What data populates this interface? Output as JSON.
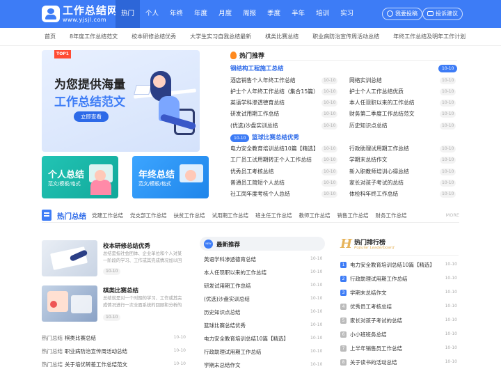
{
  "header": {
    "logo_title": "工作总结网",
    "logo_url": "www.yjsjl.com",
    "nav": [
      "热门",
      "个人",
      "年终",
      "年度",
      "月度",
      "周报",
      "季度",
      "半年",
      "培训",
      "实习"
    ],
    "pill_submit": "我要投稿",
    "pill_feedback": "投诉建议",
    "brand_color": "#3d7cf6"
  },
  "subnav": [
    "首页",
    "8年度工作总结范文",
    "校本研修总结优秀",
    "大学生实习自我总结最新",
    "棋类比赛总结",
    "职业病防治宣传周活动总结",
    "年终工作总结及明年工作计划"
  ],
  "banner": {
    "tag": "TOP1",
    "line1": "为您提供海量",
    "line2": "工作总结范文",
    "button": "立即查看"
  },
  "cards": [
    {
      "title": "个人总结",
      "sub": "范文/模板/格式"
    },
    {
      "title": "年终总结",
      "sub": "范文/模板/格式"
    }
  ],
  "hot": {
    "label": "热门推荐",
    "feature1": {
      "title": "钢结构工程施工总结",
      "date": "10-10"
    },
    "feature2": {
      "title": "篮球比赛总结优秀",
      "date": "10-10"
    },
    "left1": [
      {
        "t": "酒店销售个人年终工作总结",
        "d": "10-10"
      },
      {
        "t": "护士个人年终工作总结（集合15篇）",
        "d": "10-10"
      },
      {
        "t": "英语学科渗透德育总结",
        "d": "10-10"
      },
      {
        "t": "研发试用期工作总结",
        "d": "10-10"
      },
      {
        "t": "(优选)沙盘实训总结",
        "d": "10-10"
      }
    ],
    "right1": [
      {
        "t": "网络实训总结",
        "d": "10-10"
      },
      {
        "t": "护士个人工作总结优质",
        "d": "10-10"
      },
      {
        "t": "本人任现职以来的工作总结",
        "d": "10-10"
      },
      {
        "t": "财务第二季度工作总结范文",
        "d": "10-10"
      },
      {
        "t": "历史知识点总结",
        "d": "10-10"
      }
    ],
    "left2": [
      {
        "t": "电力安全教育培训总结10篇【精选】",
        "d": "10-10"
      },
      {
        "t": "工厂员工试用期转正个人工作总结",
        "d": "10-10"
      },
      {
        "t": "优秀员工考核总结",
        "d": "10-10"
      },
      {
        "t": "普通员工简短个人总结",
        "d": "10-10"
      },
      {
        "t": "社工岗年度考核个人总结",
        "d": "10-10"
      }
    ],
    "right2": [
      {
        "t": "行政助理试用期工作总结",
        "d": "10-10"
      },
      {
        "t": "学期末总结作文",
        "d": "10-10"
      },
      {
        "t": "新入职教师培训心得总结",
        "d": "10-10"
      },
      {
        "t": "家长对孩子考试的总结",
        "d": "10-10"
      },
      {
        "t": "体检科年终工作总结",
        "d": "10-10"
      }
    ]
  },
  "section": {
    "title": "热门总结",
    "links": [
      "党建工作总结",
      "党支部工作总结",
      "扶贫工作总结",
      "试用期工作总结",
      "班主任工作总结",
      "教师工作总结",
      "销售工作总结",
      "财务工作总结"
    ],
    "more": "MORE"
  },
  "articles": [
    {
      "title": "校本研修总结优秀",
      "desc": "总结是指社会团体、企业单位和个人对某一阶段的学习、工作或其完成情况加以回",
      "date": "10-10"
    },
    {
      "title": "棋类比赛总结",
      "desc": "总结就是对一个时期的学习、工作或其完成情况进行一次全面系统的回顾和分析的",
      "date": "10-10"
    }
  ],
  "list": [
    {
      "tag": "热门总结",
      "t": "棋类比赛总结",
      "d": "10-10"
    },
    {
      "tag": "热门总结",
      "t": "职业病防治宣传周活动总结",
      "d": "10-10"
    },
    {
      "tag": "热门总结",
      "t": "关于培优转差工作总结范文",
      "d": "10-10"
    }
  ],
  "newest": {
    "title": "最新推荐",
    "items": [
      {
        "t": "英语学科渗透德育总结",
        "d": "10-10"
      },
      {
        "t": "本人任现职以来的工作总结",
        "d": "10-10"
      },
      {
        "t": "研发试用期工作总结",
        "d": "10-10"
      },
      {
        "t": "(优选)沙盘实训总结",
        "d": "10-10"
      },
      {
        "t": "历史知识点总结",
        "d": "10-10"
      },
      {
        "t": "篮球比赛总结优秀",
        "d": "10-10"
      },
      {
        "t": "电力安全教育培训总结10篇【精选】",
        "d": "10-10"
      },
      {
        "t": "行政助理试用期工作总结",
        "d": "10-10"
      },
      {
        "t": "学期末总结作文",
        "d": "10-10"
      }
    ]
  },
  "ranking": {
    "title": "热门排行榜",
    "sub": "Popular Leaderboard",
    "items": [
      {
        "n": "1",
        "t": "电力安全教育培训总结10篇【精选】",
        "d": "10-10"
      },
      {
        "n": "2",
        "t": "行政助理试用期工作总结",
        "d": "10-10"
      },
      {
        "n": "3",
        "t": "学期末总结作文",
        "d": "10-10"
      },
      {
        "n": "4",
        "t": "优秀员工考核总结",
        "d": "10-10"
      },
      {
        "n": "5",
        "t": "家长对孩子考试的总结",
        "d": "10-10"
      },
      {
        "n": "6",
        "t": "小小班班务总结",
        "d": "10-10"
      },
      {
        "n": "7",
        "t": "上半年销售员工作总结",
        "d": "10-10"
      },
      {
        "n": "8",
        "t": "关于读书的活动总结",
        "d": "10-10"
      }
    ]
  }
}
